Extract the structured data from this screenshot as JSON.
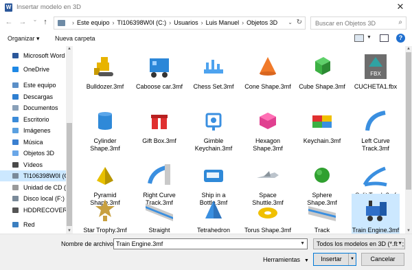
{
  "window": {
    "title": "Insertar modelo en 3D",
    "close_glyph": "✕"
  },
  "nav": {
    "back_glyph": "←",
    "forward_glyph": "→",
    "recent_glyph": "⌄",
    "up_glyph": "↑"
  },
  "address": {
    "crumbs": [
      "Este equipo",
      "TI106398W0I (C:)",
      "Usuarios",
      "Luis Manuel",
      "Objetos 3D"
    ],
    "separator": "›"
  },
  "search": {
    "placeholder": "Buscar en Objetos 3D"
  },
  "toolbar": {
    "organize": "Organizar ▾",
    "new_folder": "Nueva carpeta"
  },
  "sidebar": {
    "items": [
      {
        "label": "Microsoft Word",
        "icon": "word-icon",
        "color": "#2b579a"
      },
      {
        "label": "OneDrive",
        "icon": "cloud-icon",
        "color": "#1e88e5"
      },
      {
        "label": "Este equipo",
        "icon": "computer-icon",
        "color": "#5b8fc7"
      },
      {
        "label": "Descargas",
        "icon": "download-icon",
        "color": "#2f7fd1"
      },
      {
        "label": "Documentos",
        "icon": "document-icon",
        "color": "#8aa0b8"
      },
      {
        "label": "Escritorio",
        "icon": "desktop-icon",
        "color": "#3b8bd9"
      },
      {
        "label": "Imágenes",
        "icon": "pictures-icon",
        "color": "#5aa0e0"
      },
      {
        "label": "Música",
        "icon": "music-icon",
        "color": "#3a7fd0"
      },
      {
        "label": "Objetos 3D",
        "icon": "3d-objects-icon",
        "color": "#6aa7e8"
      },
      {
        "label": "Vídeos",
        "icon": "video-icon",
        "color": "#4a4a4a"
      },
      {
        "label": "TI106398W0I (C:)",
        "icon": "drive-icon",
        "color": "#7a8a99"
      },
      {
        "label": "Unidad de CD (E",
        "icon": "cd-drive-icon",
        "color": "#9a9a9a"
      },
      {
        "label": "Disco local (F:)",
        "icon": "drive-icon",
        "color": "#7a8a99"
      },
      {
        "label": "HDDRECOVERY",
        "icon": "drive-icon",
        "color": "#555555"
      },
      {
        "label": "Red",
        "icon": "network-icon",
        "color": "#3b7fc0"
      }
    ]
  },
  "files": [
    {
      "name": "Bulldozer.3mf",
      "icon": "bulldozer-icon",
      "color": "#e8b400"
    },
    {
      "name": "Caboose car.3mf",
      "icon": "caboose-icon",
      "color": "#2c87d8"
    },
    {
      "name": "Chess Set.3mf",
      "icon": "chess-icon",
      "color": "#4da3ef"
    },
    {
      "name": "Cone Shape.3mf",
      "icon": "cone-icon",
      "color": "#f07a2a"
    },
    {
      "name": "Cube Shape.3mf",
      "icon": "cube-icon",
      "color": "#3cb043"
    },
    {
      "name": "CUCHETA1.fbx",
      "icon": "fbx-icon",
      "color": "#2fa3a3"
    },
    {
      "name": "Cylinder Shape.3mf",
      "icon": "cylinder-icon",
      "color": "#2f89d8"
    },
    {
      "name": "Gift Box.3mf",
      "icon": "gift-icon",
      "color": "#e03030"
    },
    {
      "name": "Gimble Keychain.3mf",
      "icon": "keychain-icon",
      "color": "#3a8fe0"
    },
    {
      "name": "Hexagon Shape.3mf",
      "icon": "hexagon-icon",
      "color": "#e04090"
    },
    {
      "name": "Keychain.3mf",
      "icon": "keychain-tile-icon",
      "color": "#3a8fe0"
    },
    {
      "name": "Left Curve Track.3mf",
      "icon": "left-track-icon",
      "color": "#3a8fe0"
    },
    {
      "name": "Pyramid Shape.3mf",
      "icon": "pyramid-icon",
      "color": "#e8c000"
    },
    {
      "name": "Right Curve Track.3mf",
      "icon": "right-track-icon",
      "color": "#3a8fe0"
    },
    {
      "name": "Ship in a Bottle.3mf",
      "icon": "bottle-icon",
      "color": "#2f89d8"
    },
    {
      "name": "Space Shuttle.3mf",
      "icon": "shuttle-icon",
      "color": "#bcc4cc"
    },
    {
      "name": "Sphere Shape.3mf",
      "icon": "sphere-icon",
      "color": "#30a030"
    },
    {
      "name": "Split Track.3mf",
      "icon": "split-track-icon",
      "color": "#3a8fe0"
    },
    {
      "name": "Star Trophy.3mf",
      "icon": "trophy-icon",
      "color": "#c8a040"
    },
    {
      "name": "Straight",
      "icon": "straight-track-icon",
      "color": "#3a8fe0"
    },
    {
      "name": "Tetrahedron",
      "icon": "tetrahedron-icon",
      "color": "#3a8fe0"
    },
    {
      "name": "Torus Shape.3mf",
      "icon": "torus-icon",
      "color": "#f0c000"
    },
    {
      "name": "Track",
      "icon": "track-icon",
      "color": "#3a8fe0"
    },
    {
      "name": "Train Engine.3mf",
      "icon": "train-icon",
      "color": "#2f6fc8",
      "selected": true
    }
  ],
  "bottom": {
    "filename_label": "Nombre de archivo:",
    "filename_value": "Train Engine.3mf",
    "filetype": "Todos los modelos en 3D (*.fbx;",
    "tools": "Herramientas",
    "insert": "Insertar",
    "cancel": "Cancelar"
  },
  "colors": {
    "selection": "#cce8ff",
    "accent": "#0078d7"
  }
}
